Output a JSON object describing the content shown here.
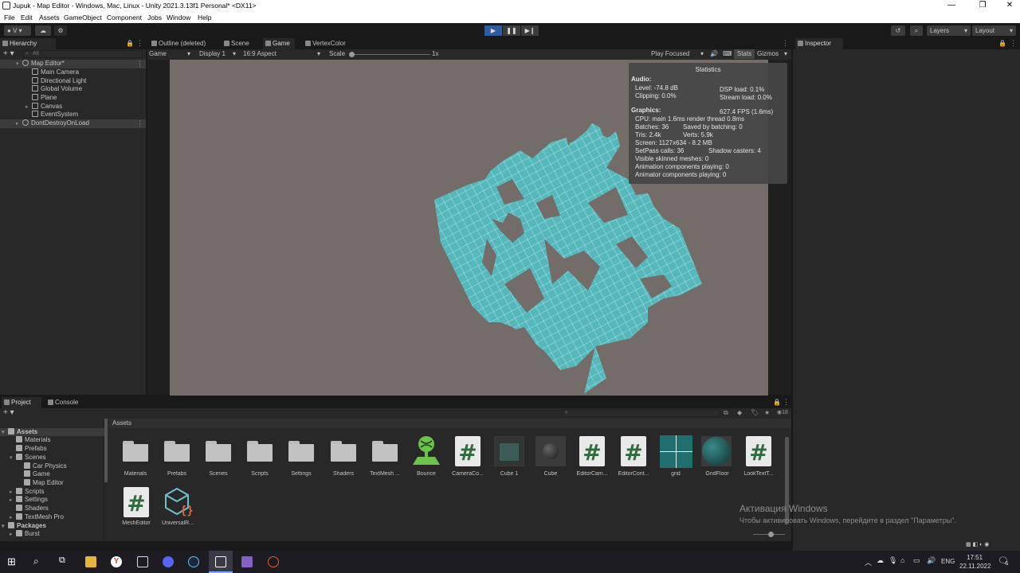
{
  "window": {
    "title": "Jupuk - Map Editor - Windows, Mac, Linux - Unity 2021.3.13f1 Personal* <DX11>"
  },
  "menu": [
    "File",
    "Edit",
    "Assets",
    "GameObject",
    "Component",
    "Jobs",
    "Window",
    "Help"
  ],
  "toolbar": {
    "account": "V",
    "layers": "Layers",
    "layout": "Layout"
  },
  "hierarchy": {
    "tab": "Hierarchy",
    "search_placeholder": "All",
    "items": [
      {
        "label": "Map Editor*",
        "indent": 0,
        "type": "scene"
      },
      {
        "label": "Main Camera",
        "indent": 1,
        "type": "object"
      },
      {
        "label": "Directional Light",
        "indent": 1,
        "type": "object"
      },
      {
        "label": "Global Volume",
        "indent": 1,
        "type": "object"
      },
      {
        "label": "Plane",
        "indent": 1,
        "type": "object"
      },
      {
        "label": "Canvas",
        "indent": 1,
        "type": "object",
        "expandable": true
      },
      {
        "label": "EventSystem",
        "indent": 1,
        "type": "object"
      },
      {
        "label": "DontDestroyOnLoad",
        "indent": 0,
        "type": "scene",
        "expandable": true
      }
    ]
  },
  "center_tabs": [
    "Outline (deleted)",
    "Scene",
    "Game",
    "VertexColor"
  ],
  "game_toolbar": {
    "mode": "Game",
    "display": "Display 1",
    "aspect": "16:9 Aspect",
    "scale_label": "Scale",
    "scale_value": "1x",
    "play_focused": "Play Focused",
    "stats": "Stats",
    "gizmos": "Gizmos"
  },
  "stats": {
    "title": "Statistics",
    "audio_header": "Audio:",
    "level": "Level: -74.8 dB",
    "clipping": "Clipping: 0.0%",
    "dsp": "DSP load: 0.1%",
    "stream": "Stream load: 0.0%",
    "graphics_header": "Graphics:",
    "fps": "627.4 FPS (1.6ms)",
    "cpu": "CPU: main 1.6ms  render thread 0.8ms",
    "batches": "Batches: 36",
    "saved": "Saved by batching: 0",
    "tris": "Tris: 2.4k",
    "verts": "Verts: 5.9k",
    "screen": "Screen: 1127x634 - 8.2 MB",
    "setpass": "SetPass calls: 36",
    "shadow": "Shadow casters: 4",
    "skinned": "Visible skinned meshes: 0",
    "anim": "Animation components playing: 0",
    "animator": "Animator components playing: 0"
  },
  "inspector": {
    "tab": "Inspector"
  },
  "bottom_tabs": [
    "Project",
    "Console"
  ],
  "project_tree": [
    {
      "label": "Assets",
      "indent": 0,
      "bold": true
    },
    {
      "label": "Materials",
      "indent": 1
    },
    {
      "label": "Prefabs",
      "indent": 1
    },
    {
      "label": "Scenes",
      "indent": 1
    },
    {
      "label": "Car Physics",
      "indent": 2
    },
    {
      "label": "Game",
      "indent": 2
    },
    {
      "label": "Map Editor",
      "indent": 2
    },
    {
      "label": "Scripts",
      "indent": 1
    },
    {
      "label": "Settings",
      "indent": 1
    },
    {
      "label": "Shaders",
      "indent": 1
    },
    {
      "label": "TextMesh Pro",
      "indent": 1
    },
    {
      "label": "Packages",
      "indent": 0,
      "bold": true
    },
    {
      "label": "Burst",
      "indent": 1
    }
  ],
  "assets_header": "Assets",
  "assets": [
    {
      "label": "Materials",
      "kind": "folder"
    },
    {
      "label": "Prefabs",
      "kind": "folder"
    },
    {
      "label": "Scenes",
      "kind": "folder"
    },
    {
      "label": "Scripts",
      "kind": "folder"
    },
    {
      "label": "Settings",
      "kind": "folder"
    },
    {
      "label": "Shaders",
      "kind": "folder"
    },
    {
      "label": "TextMesh ...",
      "kind": "folder"
    },
    {
      "label": "Bounce",
      "kind": "physics"
    },
    {
      "label": "CameraCo...",
      "kind": "script"
    },
    {
      "label": "Cube 1",
      "kind": "cube"
    },
    {
      "label": "Cube",
      "kind": "sphere-dark"
    },
    {
      "label": "EditorCam...",
      "kind": "script"
    },
    {
      "label": "EditorCont...",
      "kind": "script"
    },
    {
      "label": "grid",
      "kind": "grid"
    },
    {
      "label": "GridFloor",
      "kind": "sphere-teal"
    },
    {
      "label": "LookTextT...",
      "kind": "script"
    },
    {
      "label": "MeshEditor",
      "kind": "script"
    },
    {
      "label": "UniversalR...",
      "kind": "urp"
    }
  ],
  "assets_count": "18",
  "watermark": {
    "line1": "Активация Windows",
    "line2": "Чтобы активировать Windows, перейдите в раздел \"Параметры\"."
  },
  "taskbar": {
    "lang": "ENG",
    "time": "17:51",
    "date": "22.11.2022",
    "notif": "5"
  }
}
